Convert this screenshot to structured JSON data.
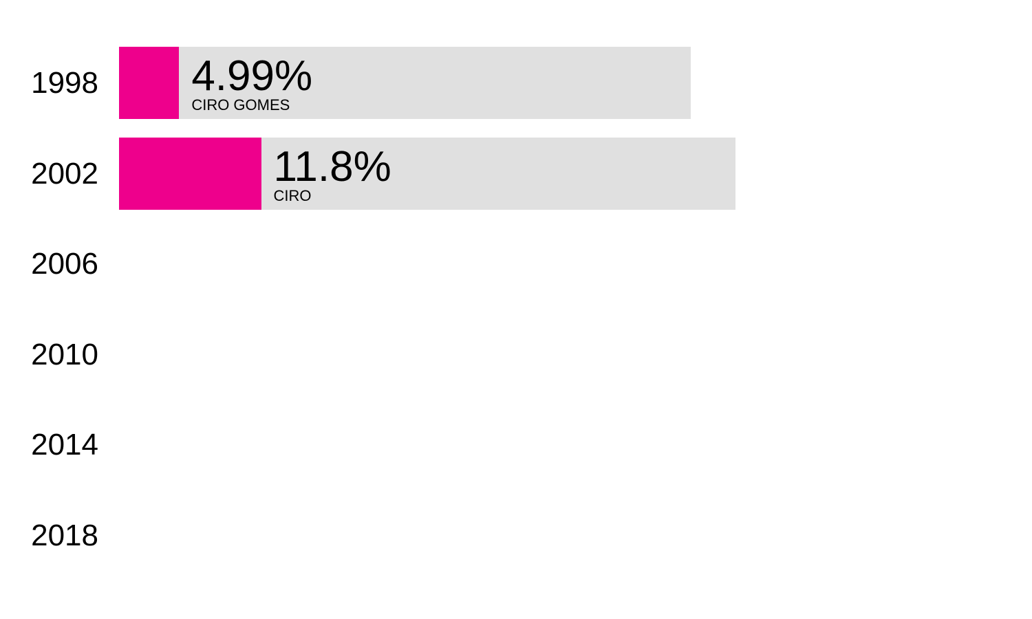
{
  "chart_data": {
    "type": "bar",
    "orientation": "horizontal",
    "categories": [
      "1998",
      "2002",
      "2006",
      "2010",
      "2014",
      "2018"
    ],
    "series": [
      {
        "values": [
          4.99,
          11.8,
          null,
          null,
          null,
          null
        ]
      }
    ],
    "total_bar_values": [
      47.5,
      51.2,
      null,
      null,
      null,
      null
    ],
    "value_labels": [
      "4.99%",
      "11.8%",
      "",
      "",
      "",
      ""
    ],
    "candidate_labels": [
      "CIRO GOMES",
      "CIRO",
      "",
      "",
      "",
      ""
    ],
    "colors": {
      "fill": "#ee008c",
      "track": "#e0e0e0",
      "text": "#000000"
    },
    "legend": "none",
    "grid": false
  }
}
